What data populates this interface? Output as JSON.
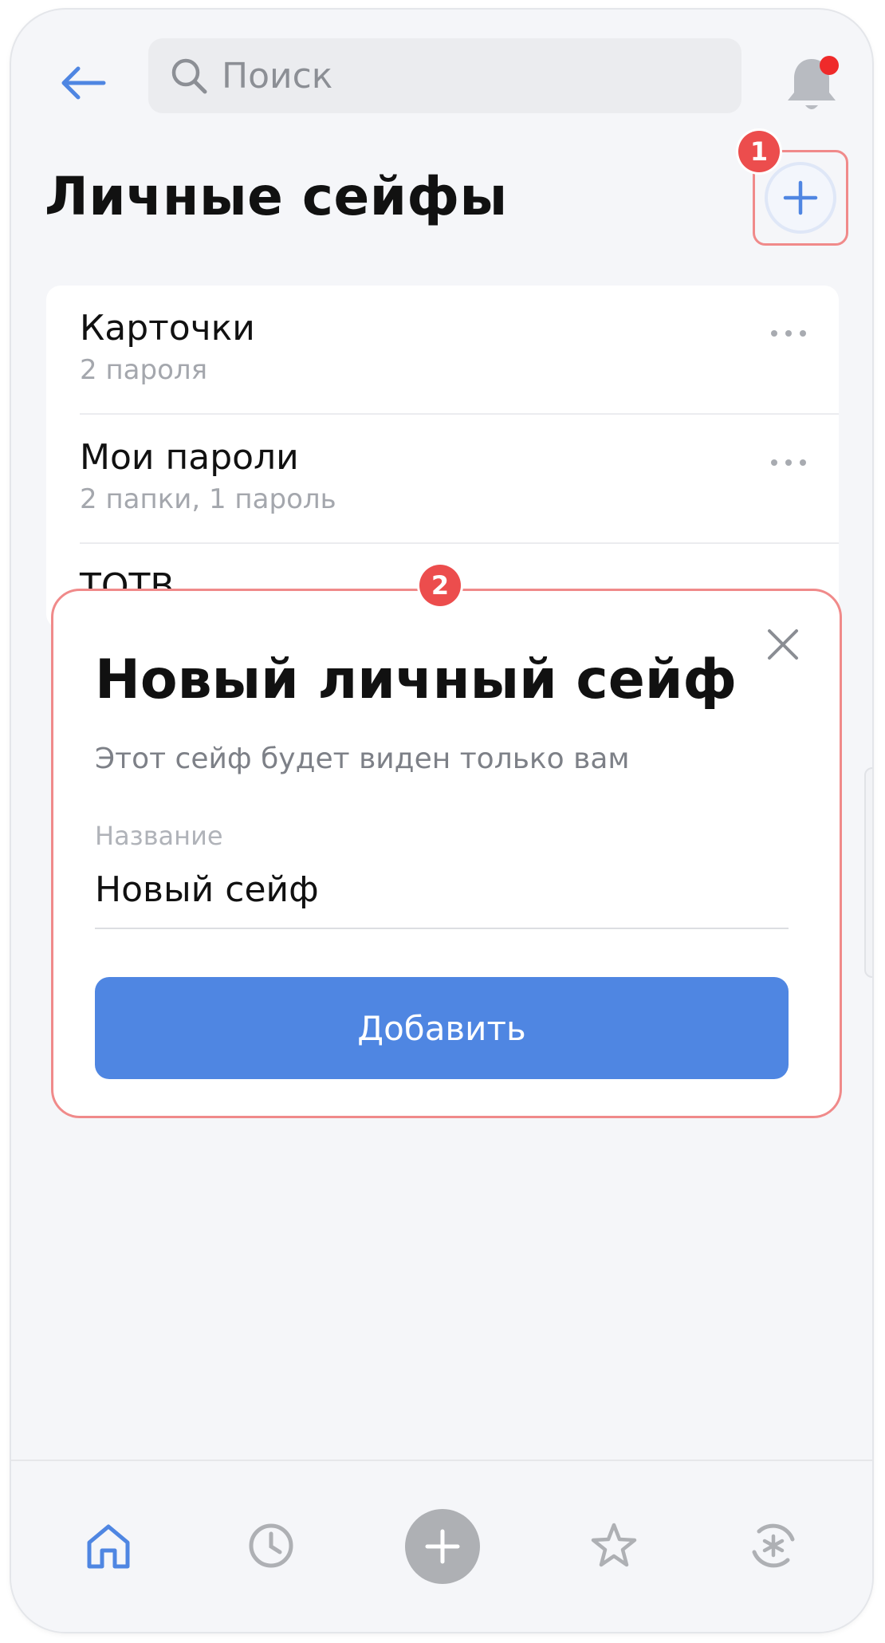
{
  "header": {
    "search_placeholder": "Поиск",
    "icons": {
      "back": "arrow-left-icon",
      "search": "magnifier-icon",
      "notifications": "bell-icon"
    }
  },
  "page": {
    "title": "Личные сейфы"
  },
  "badges": {
    "first": "1",
    "second": "2"
  },
  "vaults": [
    {
      "title": "Карточки",
      "subtitle": "2 пароля"
    },
    {
      "title": "Мои пароли",
      "subtitle": "2 папки, 1 пароль"
    },
    {
      "title": "ТОТВ",
      "subtitle": ""
    }
  ],
  "modal": {
    "title": "Новый личный сейф",
    "subtitle": "Этот сейф будет виден только вам",
    "field_label": "Название",
    "field_value": "Новый сейф",
    "submit_label": "Добавить"
  },
  "bottom_nav": {
    "items": [
      "home-icon",
      "history-icon",
      "add-icon",
      "favorites-icon",
      "password-generator-icon"
    ],
    "active": "home-icon"
  },
  "colors": {
    "accent": "#4f86e2",
    "highlight": "#f08a8a",
    "badge": "#ec4d4d"
  }
}
